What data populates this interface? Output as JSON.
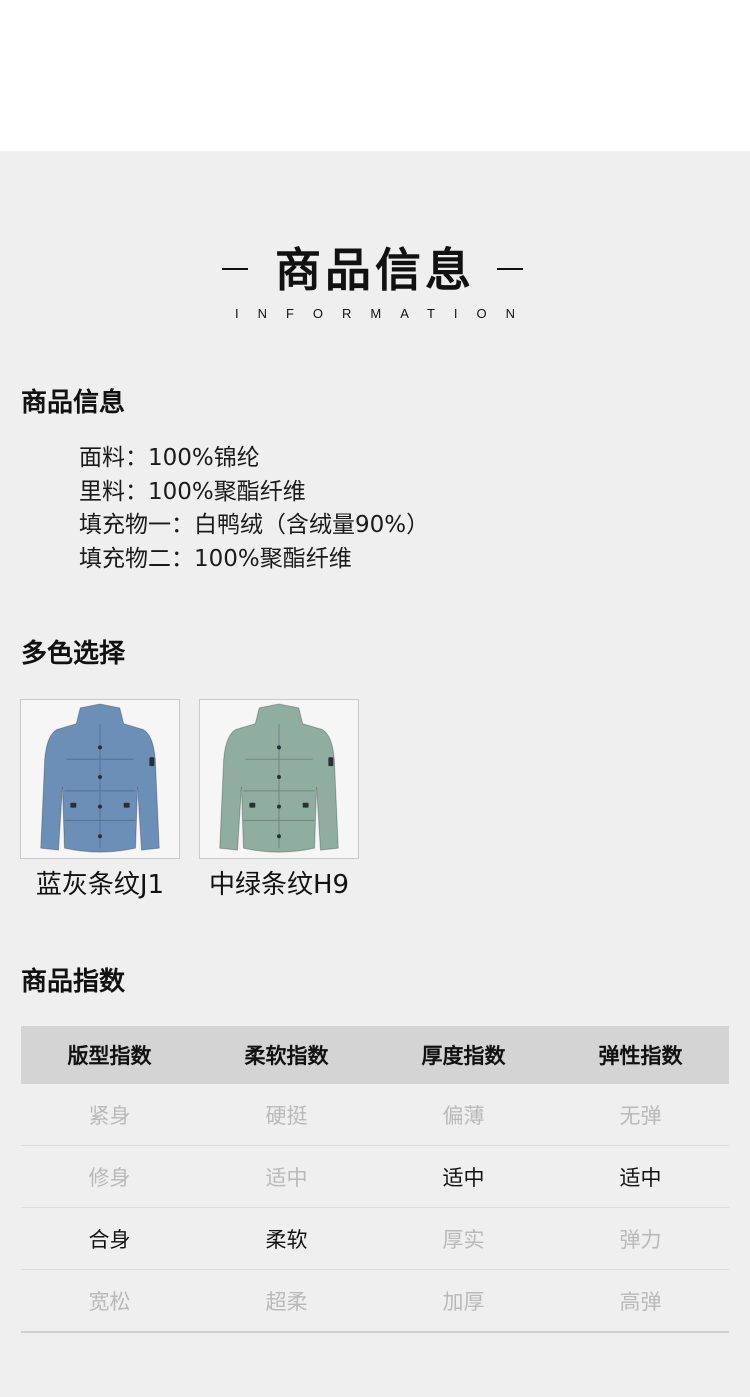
{
  "hero": {
    "title": "商品信息",
    "subtitle": "INFORMATION"
  },
  "product_info": {
    "heading": "商品信息",
    "lines": [
      "面料：100%锦纶",
      "里料：100%聚酯纤维",
      "填充物一：白鸭绒（含绒量90%）",
      "填充物二：100%聚酯纤维"
    ]
  },
  "colors": {
    "heading": "多色选择",
    "items": [
      {
        "label": "蓝灰条纹J1",
        "color": "#6c8fb8"
      },
      {
        "label": "中绿条纹H9",
        "color": "#8fae9f"
      }
    ]
  },
  "index": {
    "heading": "商品指数",
    "columns": [
      "版型指数",
      "柔软指数",
      "厚度指数",
      "弹性指数"
    ],
    "rows": [
      [
        "紧身",
        "硬挺",
        "偏薄",
        "无弹"
      ],
      [
        "修身",
        "适中",
        "适中",
        "适中"
      ],
      [
        "合身",
        "柔软",
        "厚实",
        "弹力"
      ],
      [
        "宽松",
        "超柔",
        "加厚",
        "高弹"
      ]
    ],
    "selected": [
      "合身",
      "柔软",
      "适中",
      "适中"
    ],
    "active_color": "#111111",
    "inactive_color": "#b9b9b9"
  }
}
